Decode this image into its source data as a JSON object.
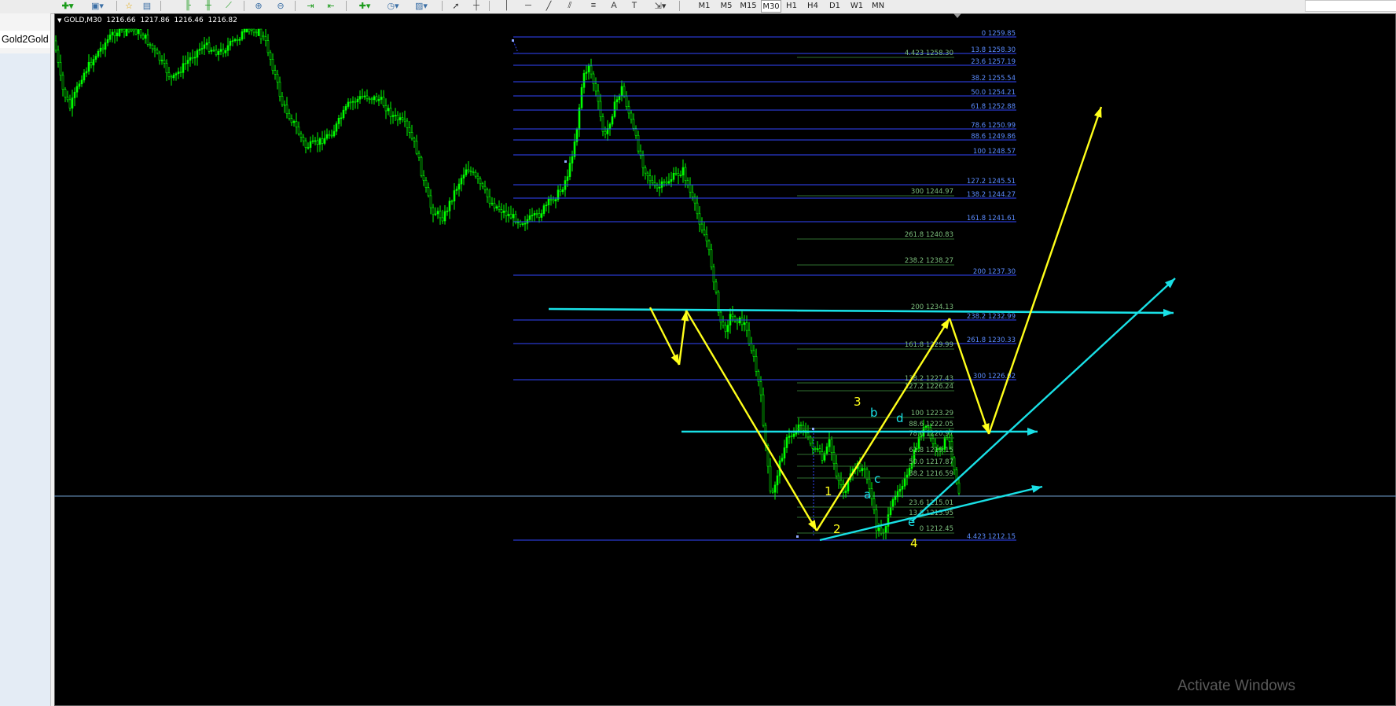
{
  "toolbar": {
    "timeframes": [
      "M1",
      "M5",
      "M15",
      "M30",
      "H1",
      "H4",
      "D1",
      "W1",
      "MN"
    ]
  },
  "left_panel": {
    "tab_label": "Gold2Gold"
  },
  "chart": {
    "symbol": "GOLD,M30",
    "open": "1216.66",
    "high": "1217.86",
    "low": "1216.46",
    "close": "1216.82"
  },
  "colors": {
    "candles": "#00ff00",
    "fib_main": "#3246ff",
    "fib_secondary": "#2f6f2f",
    "cyan": "#19e0e6",
    "yellow": "#ffff1a",
    "price_line": "#6fa0d0"
  },
  "fib_main_levels": [
    {
      "text": "0 1259.85"
    },
    {
      "text": "13.8 1258.30"
    },
    {
      "text": "23.6 1257.19"
    },
    {
      "text": "38.2 1255.54"
    },
    {
      "text": "50.0 1254.21"
    },
    {
      "text": "61.8 1252.88"
    },
    {
      "text": "78.6 1250.99"
    },
    {
      "text": "88.6 1249.86"
    },
    {
      "text": "100 1248.57"
    },
    {
      "text": "127.2 1245.51"
    },
    {
      "text": "138.2 1244.27"
    },
    {
      "text": "161.8 1241.61"
    },
    {
      "text": "200 1237.30"
    },
    {
      "text": "238.2 1232.99"
    },
    {
      "text": "261.8 1230.33"
    },
    {
      "text": "300 1226.02"
    },
    {
      "text": "4.423 1212.15"
    }
  ],
  "fib_secondary_levels": [
    {
      "text": "4.423 1258.30"
    },
    {
      "text": "300 1244.97"
    },
    {
      "text": "261.8 1240.83"
    },
    {
      "text": "238.2 1238.27"
    },
    {
      "text": "200 1234.13"
    },
    {
      "text": "161.8 1229.99"
    },
    {
      "text": "138.2 1227.43"
    },
    {
      "text": "127.2 1226.24"
    },
    {
      "text": "100 1223.29"
    },
    {
      "text": "88.6 1222.05"
    },
    {
      "text": "78.6 1220.97"
    },
    {
      "text": "61.8 1219.15"
    },
    {
      "text": "50.0 1217.87"
    },
    {
      "text": "38.2 1216.59"
    },
    {
      "text": "23.6 1215.01"
    },
    {
      "text": "13.8 1213.95"
    },
    {
      "text": "0 1212.45"
    }
  ],
  "wave_labels": [
    {
      "text": "1",
      "color": "yellow"
    },
    {
      "text": "2",
      "color": "yellow"
    },
    {
      "text": "3",
      "color": "yellow"
    },
    {
      "text": "4",
      "color": "yellow"
    },
    {
      "text": "a",
      "color": "cyan"
    },
    {
      "text": "b",
      "color": "cyan"
    },
    {
      "text": "c",
      "color": "cyan"
    },
    {
      "text": "d",
      "color": "cyan"
    },
    {
      "text": "e",
      "color": "cyan"
    }
  ],
  "watermark": "Activate Windows"
}
